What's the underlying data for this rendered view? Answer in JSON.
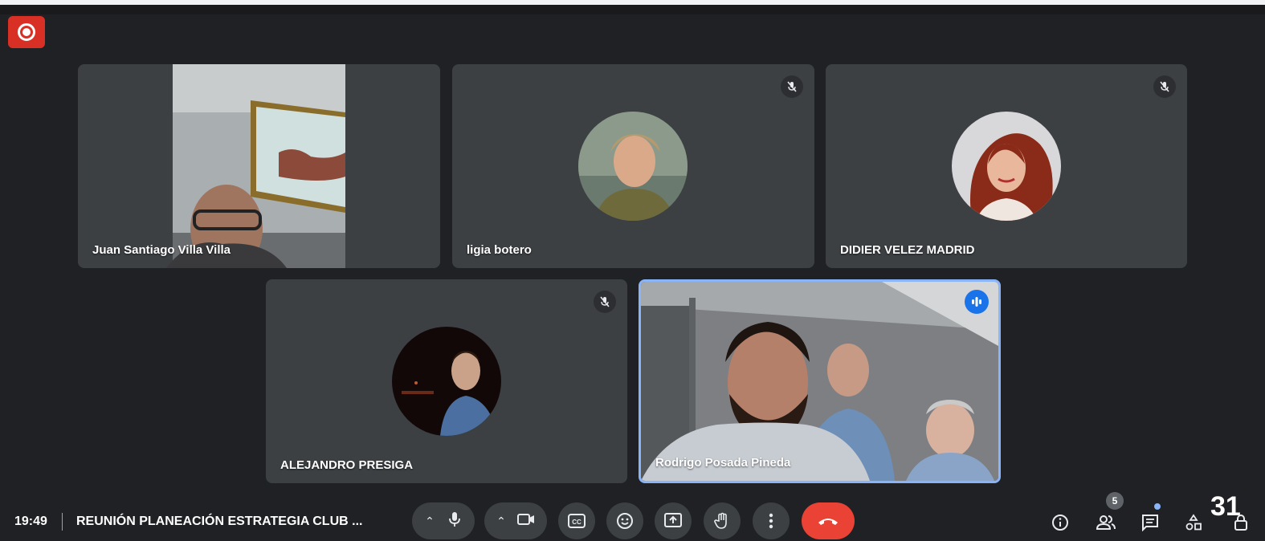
{
  "participants": [
    {
      "name": "Juan Santiago Villa Villa"
    },
    {
      "name": "ligia botero"
    },
    {
      "name": "DIDIER VELEZ MADRID"
    },
    {
      "name": "ALEJANDRO PRESIGA"
    },
    {
      "name": "Rodrigo Posada Pineda"
    }
  ],
  "bottom": {
    "time": "19:49",
    "meeting_title": "REUNIÓN PLANEACIÓN ESTRATEGIA CLUB ...",
    "people_count": "5"
  },
  "slide_number": "31",
  "colors": {
    "background": "#202124",
    "tile": "#3c4043",
    "active_border": "#8ab4f8",
    "end_call": "#ea4335",
    "record": "#d93025"
  },
  "icons": [
    "record-icon",
    "mic-off-icon",
    "speaking-icon",
    "mic-icon",
    "camera-icon",
    "captions-icon",
    "emoji-icon",
    "present-icon",
    "raise-hand-icon",
    "more-options-icon",
    "end-call-icon",
    "info-icon",
    "people-icon",
    "chat-icon",
    "activities-icon",
    "lock-icon"
  ]
}
